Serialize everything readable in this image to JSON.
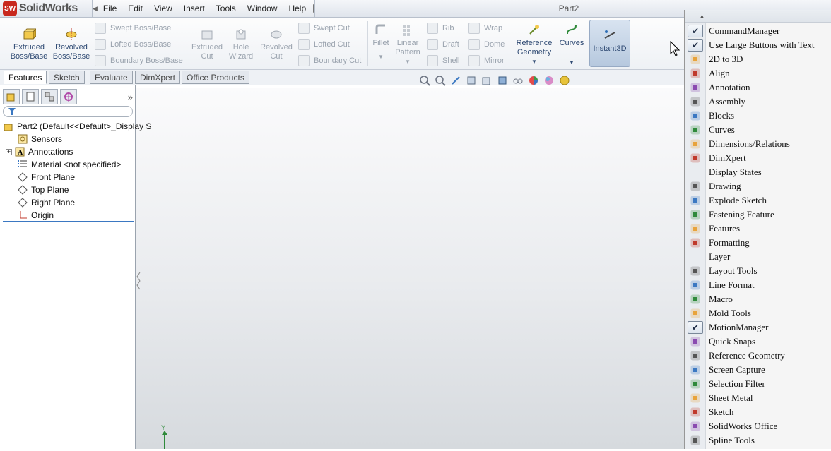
{
  "app": {
    "logo_text": "SolidWorks",
    "logo_badge": "SW",
    "document_title": "Part2"
  },
  "menu": {
    "items": [
      "File",
      "Edit",
      "View",
      "Insert",
      "Tools",
      "Window",
      "Help"
    ]
  },
  "command_manager": {
    "extruded_boss": "Extruded Boss/Base",
    "revolved_boss": "Revolved Boss/Base",
    "swept_boss": "Swept Boss/Base",
    "lofted_boss": "Lofted Boss/Base",
    "boundary_boss": "Boundary Boss/Base",
    "extruded_cut": "Extruded Cut",
    "hole_wizard": "Hole Wizard",
    "revolved_cut": "Revolved Cut",
    "swept_cut": "Swept Cut",
    "lofted_cut": "Lofted Cut",
    "boundary_cut": "Boundary Cut",
    "fillet": "Fillet",
    "linear_pattern": "Linear Pattern",
    "rib": "Rib",
    "draft": "Draft",
    "shell": "Shell",
    "wrap": "Wrap",
    "dome": "Dome",
    "mirror": "Mirror",
    "reference_geometry": "Reference Geometry",
    "curves": "Curves",
    "instant3d": "Instant3D"
  },
  "tabs": [
    "Features",
    "Sketch",
    "Evaluate",
    "DimXpert",
    "Office Products"
  ],
  "feature_tree": {
    "root": "Part2  (Default<<Default>_Display S",
    "items": [
      "Sensors",
      "Annotations",
      "Material <not specified>",
      "Front Plane",
      "Top Plane",
      "Right Plane",
      "Origin"
    ]
  },
  "graphics": {
    "axis_label": "Y"
  },
  "context_menu": {
    "items": [
      {
        "label": "CommandManager",
        "checked": true
      },
      {
        "label": "Use Large Buttons with Text",
        "checked": true
      },
      {
        "label": "2D to 3D",
        "icon": "2d-to-3d-icon"
      },
      {
        "label": "Align",
        "icon": "align-icon"
      },
      {
        "label": "Annotation",
        "icon": "annotation-icon"
      },
      {
        "label": "Assembly",
        "icon": "assembly-icon"
      },
      {
        "label": "Blocks",
        "icon": "blocks-icon"
      },
      {
        "label": "Curves",
        "icon": "curves-icon"
      },
      {
        "label": "Dimensions/Relations",
        "icon": "dimensions-icon"
      },
      {
        "label": "DimXpert",
        "icon": "dimxpert-icon"
      },
      {
        "label": "Display States",
        "icon": ""
      },
      {
        "label": "Drawing",
        "icon": "drawing-icon"
      },
      {
        "label": "Explode Sketch",
        "icon": "explode-sketch-icon"
      },
      {
        "label": "Fastening Feature",
        "icon": "fastening-icon"
      },
      {
        "label": "Features",
        "icon": "features-icon"
      },
      {
        "label": "Formatting",
        "icon": "formatting-icon"
      },
      {
        "label": "Layer",
        "icon": ""
      },
      {
        "label": "Layout Tools",
        "icon": "layout-tools-icon"
      },
      {
        "label": "Line Format",
        "icon": "line-format-icon"
      },
      {
        "label": "Macro",
        "icon": "macro-icon"
      },
      {
        "label": "Mold Tools",
        "icon": "mold-tools-icon"
      },
      {
        "label": "MotionManager",
        "checked": true
      },
      {
        "label": "Quick Snaps",
        "icon": "quick-snaps-icon"
      },
      {
        "label": "Reference Geometry",
        "icon": "reference-geometry-icon"
      },
      {
        "label": "Screen Capture",
        "icon": "screen-capture-icon"
      },
      {
        "label": "Selection Filter",
        "icon": "selection-filter-icon"
      },
      {
        "label": "Sheet Metal",
        "icon": "sheet-metal-icon"
      },
      {
        "label": "Sketch",
        "icon": "sketch-icon"
      },
      {
        "label": "SolidWorks Office",
        "icon": "solidworks-office-icon"
      },
      {
        "label": "Spline Tools",
        "icon": "spline-tools-icon"
      }
    ]
  }
}
